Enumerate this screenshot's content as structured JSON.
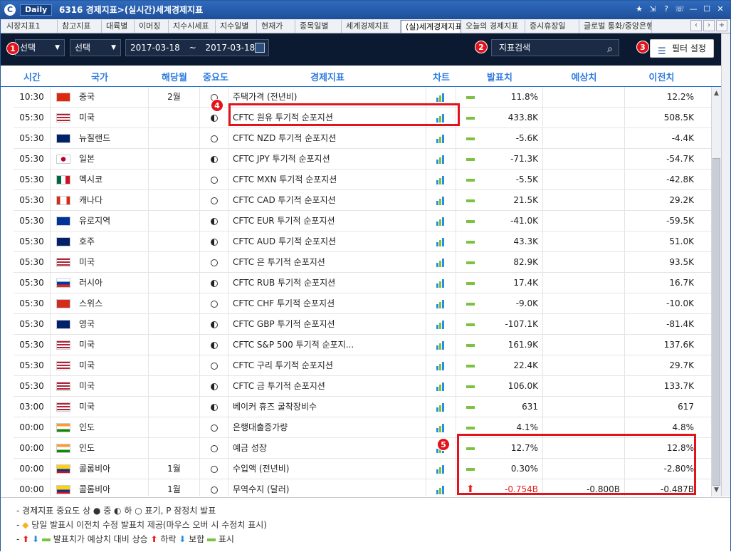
{
  "window": {
    "daily": "Daily",
    "title": "6316 경제지표>(실시간)세계경제지표",
    "logo": "C"
  },
  "tabs": [
    "시장지표1",
    "참고지표",
    "대륙별",
    "이머징",
    "지수시세표",
    "지수일별",
    "현재가",
    "종목일별",
    "세계경제지표",
    "(실)세계경제지표",
    "오늘의 경제지표",
    "증시휴장일",
    "글로벌 통화/중앙은행"
  ],
  "active_tab": "(실)세계경제지표",
  "toolbar": {
    "select1": "선택",
    "select2": "선택",
    "date_from": "2017-03-18",
    "date_sep": "~",
    "date_to": "2017-03-18",
    "search_placeholder": "지표검색",
    "filter_label": "필터 설정"
  },
  "badges": [
    "1",
    "2",
    "3",
    "4",
    "5"
  ],
  "columns": {
    "time": "시간",
    "country": "국가",
    "month": "해당월",
    "importance": "중요도",
    "indicator": "경제지표",
    "chart": "차트",
    "actual": "발표치",
    "forecast": "예상치",
    "previous": "이전치"
  },
  "rows": [
    {
      "time": "10:30",
      "country": "중국",
      "flag": "cn",
      "month": "2월",
      "imp": "low",
      "indicator": "주택가격 (전년비)",
      "actual": "11.8%",
      "forecast": "",
      "previous": "12.2%",
      "trend": "same"
    },
    {
      "time": "05:30",
      "country": "미국",
      "flag": "us",
      "month": "",
      "imp": "mid",
      "indicator": "CFTC 원유 투기적 순포지션",
      "actual": "433.8K",
      "forecast": "",
      "previous": "508.5K",
      "trend": "same"
    },
    {
      "time": "05:30",
      "country": "뉴질랜드",
      "flag": "nz",
      "month": "",
      "imp": "low",
      "indicator": "CFTC NZD 투기적 순포지션",
      "actual": "-5.6K",
      "forecast": "",
      "previous": "-4.4K",
      "trend": "same"
    },
    {
      "time": "05:30",
      "country": "일본",
      "flag": "jp",
      "month": "",
      "imp": "mid",
      "indicator": "CFTC JPY 투기적 순포지션",
      "actual": "-71.3K",
      "forecast": "",
      "previous": "-54.7K",
      "trend": "same"
    },
    {
      "time": "05:30",
      "country": "멕시코",
      "flag": "mx",
      "month": "",
      "imp": "low",
      "indicator": "CFTC MXN 투기적 순포지션",
      "actual": "-5.5K",
      "forecast": "",
      "previous": "-42.8K",
      "trend": "same"
    },
    {
      "time": "05:30",
      "country": "캐나다",
      "flag": "ca",
      "month": "",
      "imp": "low",
      "indicator": "CFTC CAD 투기적 순포지션",
      "actual": "21.5K",
      "forecast": "",
      "previous": "29.2K",
      "trend": "same"
    },
    {
      "time": "05:30",
      "country": "유로지역",
      "flag": "eu",
      "month": "",
      "imp": "mid",
      "indicator": "CFTC EUR 투기적 순포지션",
      "actual": "-41.0K",
      "forecast": "",
      "previous": "-59.5K",
      "trend": "same"
    },
    {
      "time": "05:30",
      "country": "호주",
      "flag": "au",
      "month": "",
      "imp": "mid",
      "indicator": "CFTC AUD 투기적 순포지션",
      "actual": "43.3K",
      "forecast": "",
      "previous": "51.0K",
      "trend": "same"
    },
    {
      "time": "05:30",
      "country": "미국",
      "flag": "us",
      "month": "",
      "imp": "low",
      "indicator": "CFTC 은 투기적 순포지션",
      "actual": "82.9K",
      "forecast": "",
      "previous": "93.5K",
      "trend": "same"
    },
    {
      "time": "05:30",
      "country": "러시아",
      "flag": "ru",
      "month": "",
      "imp": "mid",
      "indicator": "CFTC RUB 투기적 순포지션",
      "actual": "17.4K",
      "forecast": "",
      "previous": "16.7K",
      "trend": "same"
    },
    {
      "time": "05:30",
      "country": "스위스",
      "flag": "ch",
      "month": "",
      "imp": "low",
      "indicator": "CFTC CHF 투기적 순포지션",
      "actual": "-9.0K",
      "forecast": "",
      "previous": "-10.0K",
      "trend": "same"
    },
    {
      "time": "05:30",
      "country": "영국",
      "flag": "gb",
      "month": "",
      "imp": "mid",
      "indicator": "CFTC GBP 투기적 순포지션",
      "actual": "-107.1K",
      "forecast": "",
      "previous": "-81.4K",
      "trend": "same"
    },
    {
      "time": "05:30",
      "country": "미국",
      "flag": "us",
      "month": "",
      "imp": "mid",
      "indicator": "CFTC S&P 500 투기적 순포지...",
      "actual": "161.9K",
      "forecast": "",
      "previous": "137.6K",
      "trend": "same"
    },
    {
      "time": "05:30",
      "country": "미국",
      "flag": "us",
      "month": "",
      "imp": "low",
      "indicator": "CFTC 구리 투기적 순포지션",
      "actual": "22.4K",
      "forecast": "",
      "previous": "29.7K",
      "trend": "same"
    },
    {
      "time": "05:30",
      "country": "미국",
      "flag": "us",
      "month": "",
      "imp": "mid",
      "indicator": "CFTC 금 투기적 순포지션",
      "actual": "106.0K",
      "forecast": "",
      "previous": "133.7K",
      "trend": "same"
    },
    {
      "time": "03:00",
      "country": "미국",
      "flag": "us",
      "month": "",
      "imp": "mid",
      "indicator": "베이커 휴즈 굴착장비수",
      "actual": "631",
      "forecast": "",
      "previous": "617",
      "trend": "same"
    },
    {
      "time": "00:00",
      "country": "인도",
      "flag": "in",
      "month": "",
      "imp": "low",
      "indicator": "은행대출증가량",
      "actual": "4.1%",
      "forecast": "",
      "previous": "4.8%",
      "trend": "same"
    },
    {
      "time": "00:00",
      "country": "인도",
      "flag": "in",
      "month": "",
      "imp": "low",
      "indicator": "예금 성장",
      "actual": "12.7%",
      "forecast": "",
      "previous": "12.8%",
      "trend": "same"
    },
    {
      "time": "00:00",
      "country": "콜롬비아",
      "flag": "co",
      "month": "1월",
      "imp": "low",
      "indicator": "수입액 (전년비)",
      "actual": "0.30%",
      "forecast": "",
      "previous": "-2.80%",
      "trend": "same"
    },
    {
      "time": "00:00",
      "country": "콜롬비아",
      "flag": "co",
      "month": "1월",
      "imp": "low",
      "indicator": "무역수지 (달러)",
      "actual": "-0.754B",
      "forecast": "-0.800B",
      "previous": "-0.487B",
      "trend": "up"
    }
  ],
  "footer": {
    "line1": "경제지표 중요도 상 ● 중 ◐ 하 ○ 표기, P 잠정치 발표",
    "line2": "당일 발표시 이전치 수정 발표치 제공(마우스 오버 시 수정치 표시)",
    "line3": "발표치가 예상치 대비 상승 ",
    "line3b": " 하락 ",
    "line3c": " 보합 ",
    "line3d": " 표시"
  },
  "colors": {
    "accent": "#2f7be0",
    "up": "#e8211b",
    "down": "#2a8ee0",
    "same": "#7bc142",
    "highlight": "#e2131b",
    "toolbar_bg": "#0c1a31"
  }
}
